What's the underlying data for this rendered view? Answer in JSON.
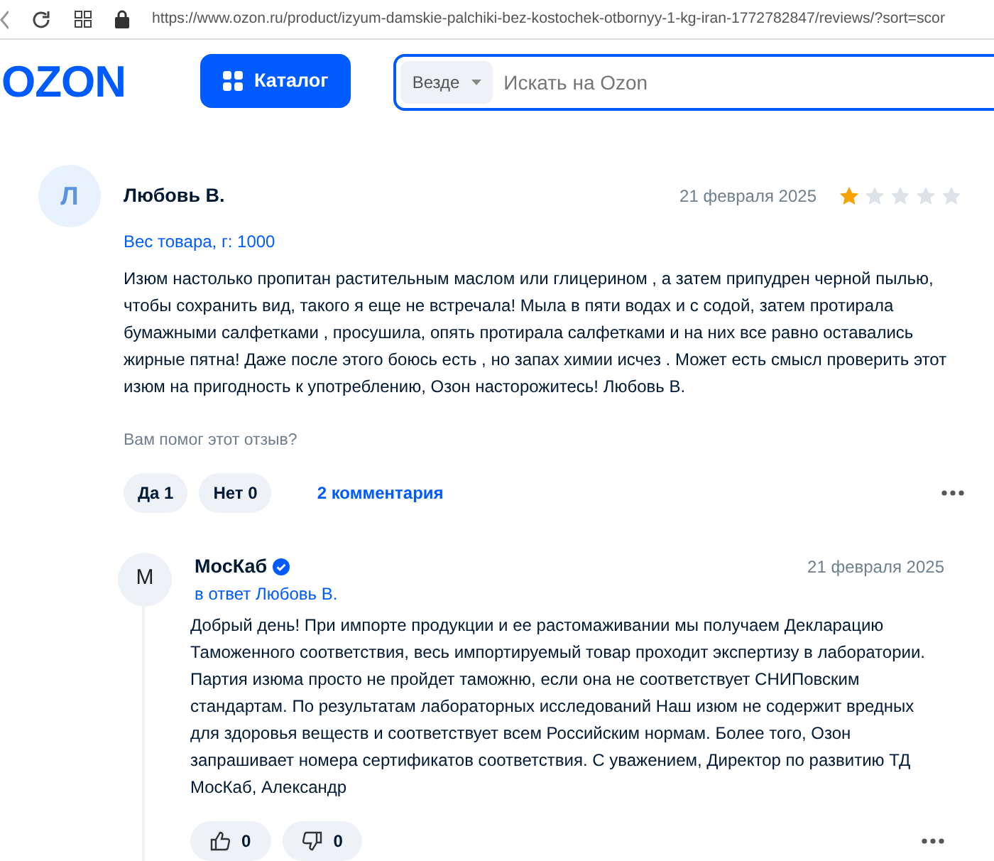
{
  "browser": {
    "url": "https://www.ozon.ru/product/izyum-damskie-palchiki-bez-kostochek-otbornyy-1-kg-iran-1772782847/reviews/?sort=scor"
  },
  "header": {
    "logo": "OZON",
    "catalog_button": "Каталог",
    "search": {
      "scope": "Везде",
      "placeholder": "Искать на Ozon"
    }
  },
  "review": {
    "avatar_letter": "Л",
    "author": "Любовь В.",
    "date": "21 февраля 2025",
    "stars": 1,
    "product_option": "Вес товара, г: 1000",
    "text": "Изюм настолько пропитан растительным маслом или глицерином , а затем припудрен черной пылью, чтобы сохранить вид, такого я еще не встречала! Мыла в пяти водах и с содой, затем протирала бумажными салфетками , просушила, опять протирала салфетками и на них все равно оставались жирные пятна! Даже после этого боюсь есть , но запах химии исчез . Может есть смысл проверить этот изюм на пригодность к употреблению, Озон насторожитесь! Любовь В.",
    "helpful_question": "Вам помог этот отзыв?",
    "votes": [
      "Да 1",
      "Нет 0"
    ],
    "comments_link": "2 комментария"
  },
  "reply": {
    "avatar_letter": "М",
    "author": "МосКаб",
    "verified": true,
    "in_reply_to": "в ответ Любовь В.",
    "date": "21 февраля 2025",
    "text": "Добрый день! При импорте продукции и ее растомаживании мы получаем Декларацию Таможенного соответствия, весь импортируемый товар проходит экспертизу в лаборатории. Партия изюма просто не пройдет таможню, если она не соответствует СНИПовским стандартам. По результатам лабораторных исследований Наш изюм не содержит вредных для здоровья веществ и соответствует всем Российским нормам. Более того, Озон запрашивает номера сертификатов соответствия. С уважением, Директор по развитию ТД МосКаб, Александр",
    "likes": "0",
    "dislikes": "0"
  }
}
